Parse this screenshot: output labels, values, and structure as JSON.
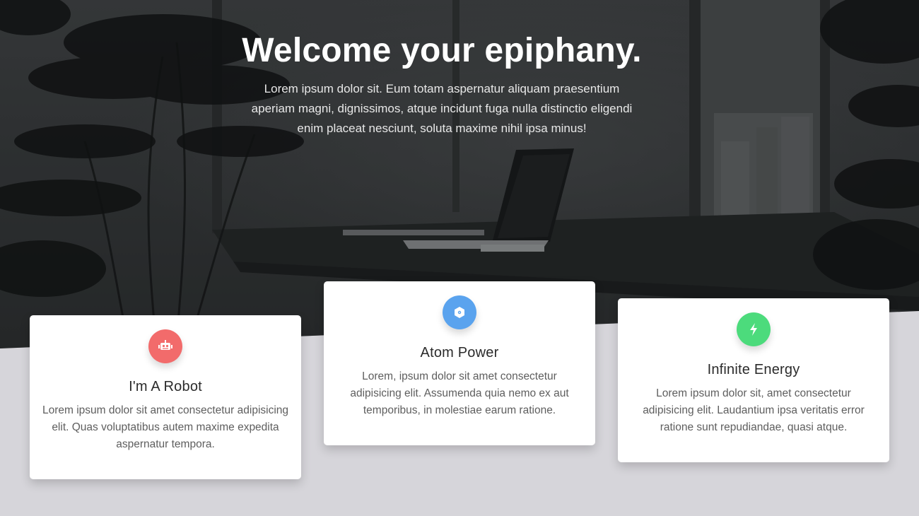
{
  "hero": {
    "title": "Welcome your epiphany.",
    "subtitle": "Lorem ipsum dolor sit. Eum totam aspernatur aliquam praesentium aperiam magni, dignissimos, atque incidunt fuga nulla distinctio eligendi enim placeat nesciunt, soluta maxime nihil ipsa minus!"
  },
  "features": [
    {
      "icon": "robot-icon",
      "color": "#f26b6b",
      "title": "I'm A Robot",
      "text": "Lorem ipsum dolor sit amet consectetur adipisicing elit. Quas voluptatibus autem maxime expedita aspernatur tempora."
    },
    {
      "icon": "atom-icon",
      "color": "#5aa3ee",
      "title": "Atom Power",
      "text": "Lorem, ipsum dolor sit amet consectetur adipisicing elit. Assumenda quia nemo ex aut temporibus, in molestiae earum ratione."
    },
    {
      "icon": "lightning-icon",
      "color": "#4cdb7c",
      "title": "Infinite Energy",
      "text": "Lorem ipsum dolor sit, amet consectetur adipisicing elit. Laudantium ipsa veritatis error ratione sunt repudiandae, quasi atque."
    }
  ]
}
